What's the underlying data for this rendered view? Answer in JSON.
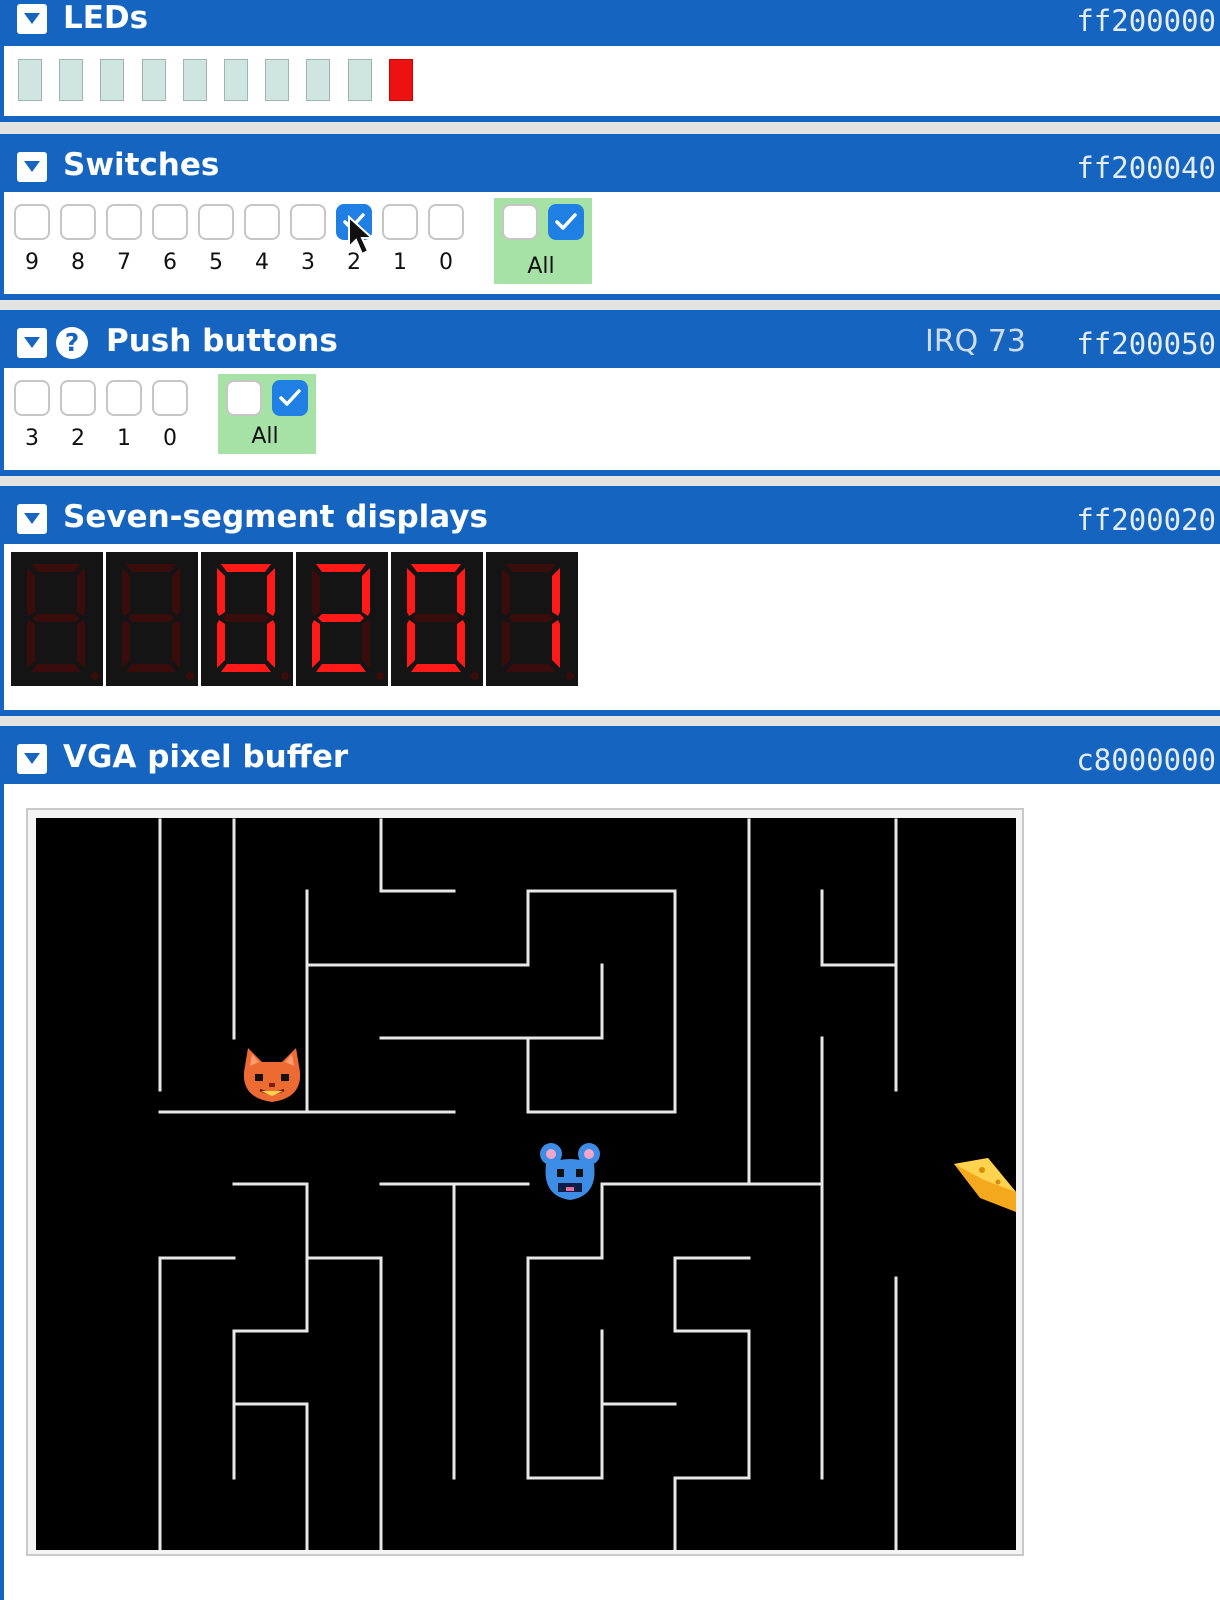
{
  "leds": {
    "title": "LEDs",
    "address": "ff200000",
    "states": [
      false,
      false,
      false,
      false,
      false,
      false,
      false,
      false,
      false,
      true
    ]
  },
  "switches": {
    "title": "Switches",
    "address": "ff200040",
    "labels": [
      "9",
      "8",
      "7",
      "6",
      "5",
      "4",
      "3",
      "2",
      "1",
      "0"
    ],
    "checked": [
      false,
      false,
      false,
      false,
      false,
      false,
      false,
      true,
      false,
      false
    ],
    "all_label": "All"
  },
  "push_buttons": {
    "title": "Push buttons",
    "irq": "IRQ 73",
    "address": "ff200050",
    "labels": [
      "3",
      "2",
      "1",
      "0"
    ],
    "all_label": "All"
  },
  "seven_segment": {
    "title": "Seven-segment displays",
    "address": "ff200020",
    "digits": [
      "",
      "",
      "0",
      "2",
      "0",
      "1"
    ]
  },
  "vga": {
    "title": "VGA pixel buffer",
    "address": "c8000000"
  },
  "colors": {
    "header": "#1565c0",
    "led_on": "#ee1111",
    "led_off": "#cfe6e0",
    "segment_on": "#ff1a1a",
    "segment_off": "#3a0d0d",
    "all_box": "#a6e2a6",
    "checkbox_checked": "#1f7fe3"
  },
  "icons": [
    "chevron-down-icon",
    "help-icon",
    "check-icon",
    "cursor-icon",
    "cat-sprite",
    "mouse-sprite",
    "cheese-sprite"
  ]
}
